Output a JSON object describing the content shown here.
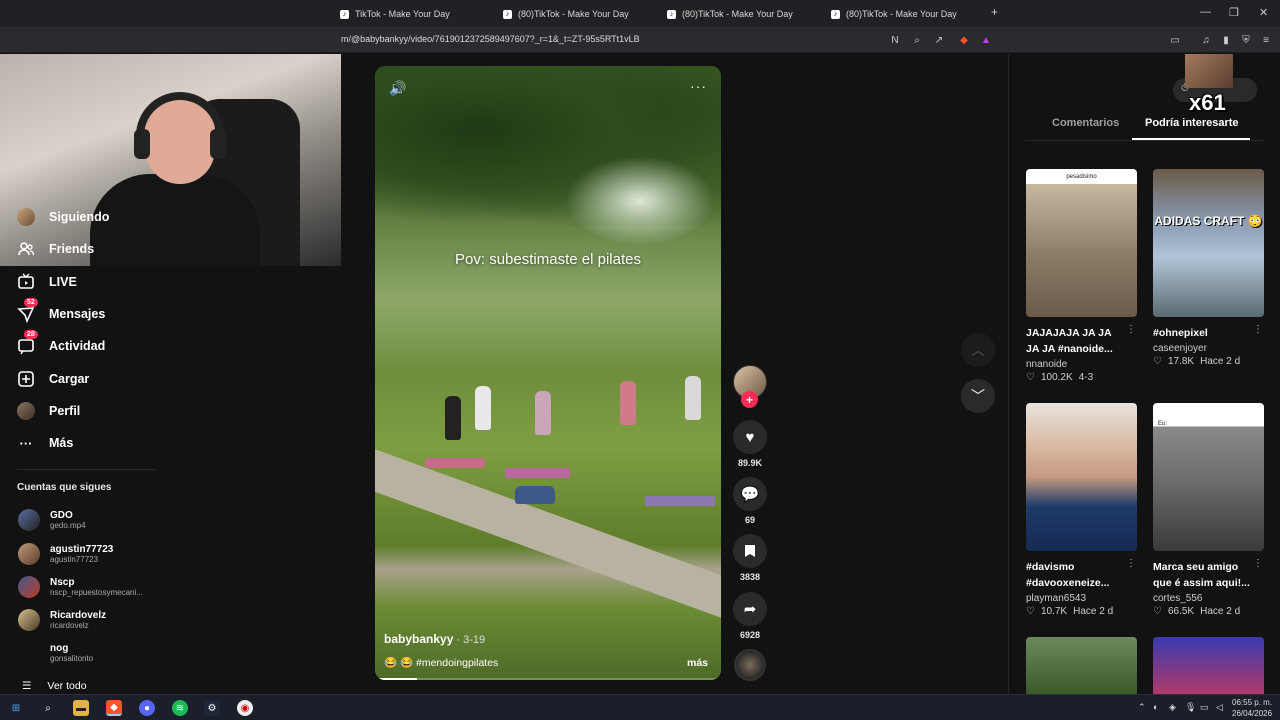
{
  "browser": {
    "tabs": [
      {
        "label": "TikTok - Make Your Day"
      },
      {
        "label": "(80)TikTok - Make Your Day"
      },
      {
        "label": "(80)TikTok - Make Your Day"
      },
      {
        "label": "(80)TikTok - Make Your Day"
      }
    ],
    "new_tab": "+",
    "url": "m/@babybankyy/video/7619012372589497607?_r=1&_t=ZT-95s5RTt1vLB"
  },
  "nav": {
    "items": [
      {
        "label": "Siguiendo",
        "icon": "avatar-icon"
      },
      {
        "label": "Friends",
        "icon": "friends-icon"
      },
      {
        "label": "LIVE",
        "icon": "live-icon"
      },
      {
        "label": "Mensajes",
        "icon": "messages-icon",
        "badge": "52"
      },
      {
        "label": "Actividad",
        "icon": "activity-icon",
        "badge": "28"
      },
      {
        "label": "Cargar",
        "icon": "upload-icon"
      },
      {
        "label": "Perfil",
        "icon": "profile-icon"
      },
      {
        "label": "Más",
        "icon": "more-icon"
      }
    ],
    "following_title": "Cuentas que sigues",
    "accounts": [
      {
        "name": "GDO",
        "username": "gedo.mp4"
      },
      {
        "name": "agustin77723",
        "username": "agustin77723"
      },
      {
        "name": "Nscp",
        "username": "nscp_repuestosymecani..."
      },
      {
        "name": "Ricardovelz",
        "username": "ricardovelz"
      },
      {
        "name": "nog",
        "username": "gonsalitonto"
      }
    ],
    "see_all": "Ver todo"
  },
  "video": {
    "overlay_text": "Pov: subestimaste el pilates",
    "author": "babybankyy",
    "date": " · 3-19",
    "caption": "😂 😂 #mendoingpilates",
    "more": "más",
    "progress": 0.12
  },
  "actions": {
    "likes": "89.9K",
    "comments": "69",
    "saves": "3838",
    "shares": "6928"
  },
  "right_panel": {
    "overlay_badge": "x61",
    "tabs": [
      {
        "label": "Comentarios",
        "active": false
      },
      {
        "label": "Podría interesarte",
        "active": true
      }
    ],
    "cards": [
      {
        "thumb_text": "pesadisimo",
        "title": "JAJAJAJA JA JA JA JA #nanoide...",
        "user": "nnanoide",
        "likes": "100.2K",
        "date": "4-3"
      },
      {
        "thumb_text": "ADIDAS CRAFT 😳",
        "title": "#ohnepixel",
        "user": "caseenjoyer",
        "likes": "17.8K",
        "date": "Hace 2 d"
      },
      {
        "thumb_text": "",
        "title": "#davismo #davooxeneize...",
        "user": "playman6543",
        "likes": "10.7K",
        "date": "Hace 2 d"
      },
      {
        "thumb_text": "Eu:",
        "title": "Marca seu amigo que é assim aqui!...",
        "user": "cortes_556",
        "likes": "66.5K",
        "date": "Hace 2 d"
      }
    ]
  },
  "taskbar": {
    "time": "06:55 p. m.",
    "date": "26/04/2026"
  }
}
